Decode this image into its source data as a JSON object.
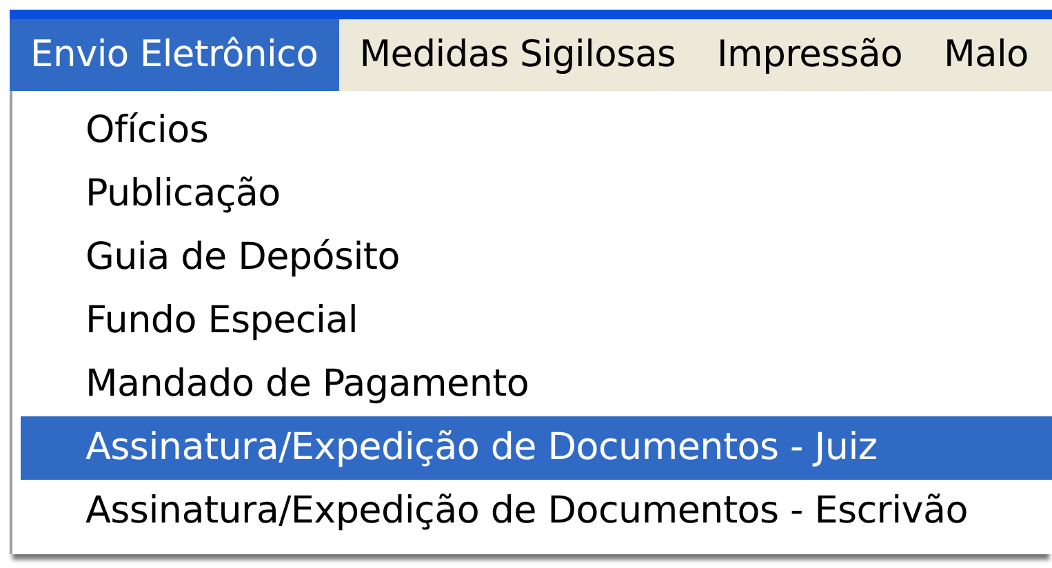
{
  "menu_bar": [
    {
      "label": "Envio Eletrônico",
      "selected": true
    },
    {
      "label": "Medidas Sigilosas",
      "selected": false
    },
    {
      "label": "Impressão",
      "selected": false
    },
    {
      "label": "Malo",
      "selected": false
    }
  ],
  "dropdown": [
    {
      "label": "Ofícios",
      "selected": false
    },
    {
      "label": "Publicação",
      "selected": false
    },
    {
      "label": "Guia de Depósito",
      "selected": false
    },
    {
      "label": "Fundo Especial",
      "selected": false
    },
    {
      "label": "Mandado de Pagamento",
      "selected": false
    },
    {
      "label": "Assinatura/Expedição de Documentos - Juiz",
      "selected": true
    },
    {
      "label": "Assinatura/Expedição de Documentos - Escrivão",
      "selected": false
    }
  ]
}
